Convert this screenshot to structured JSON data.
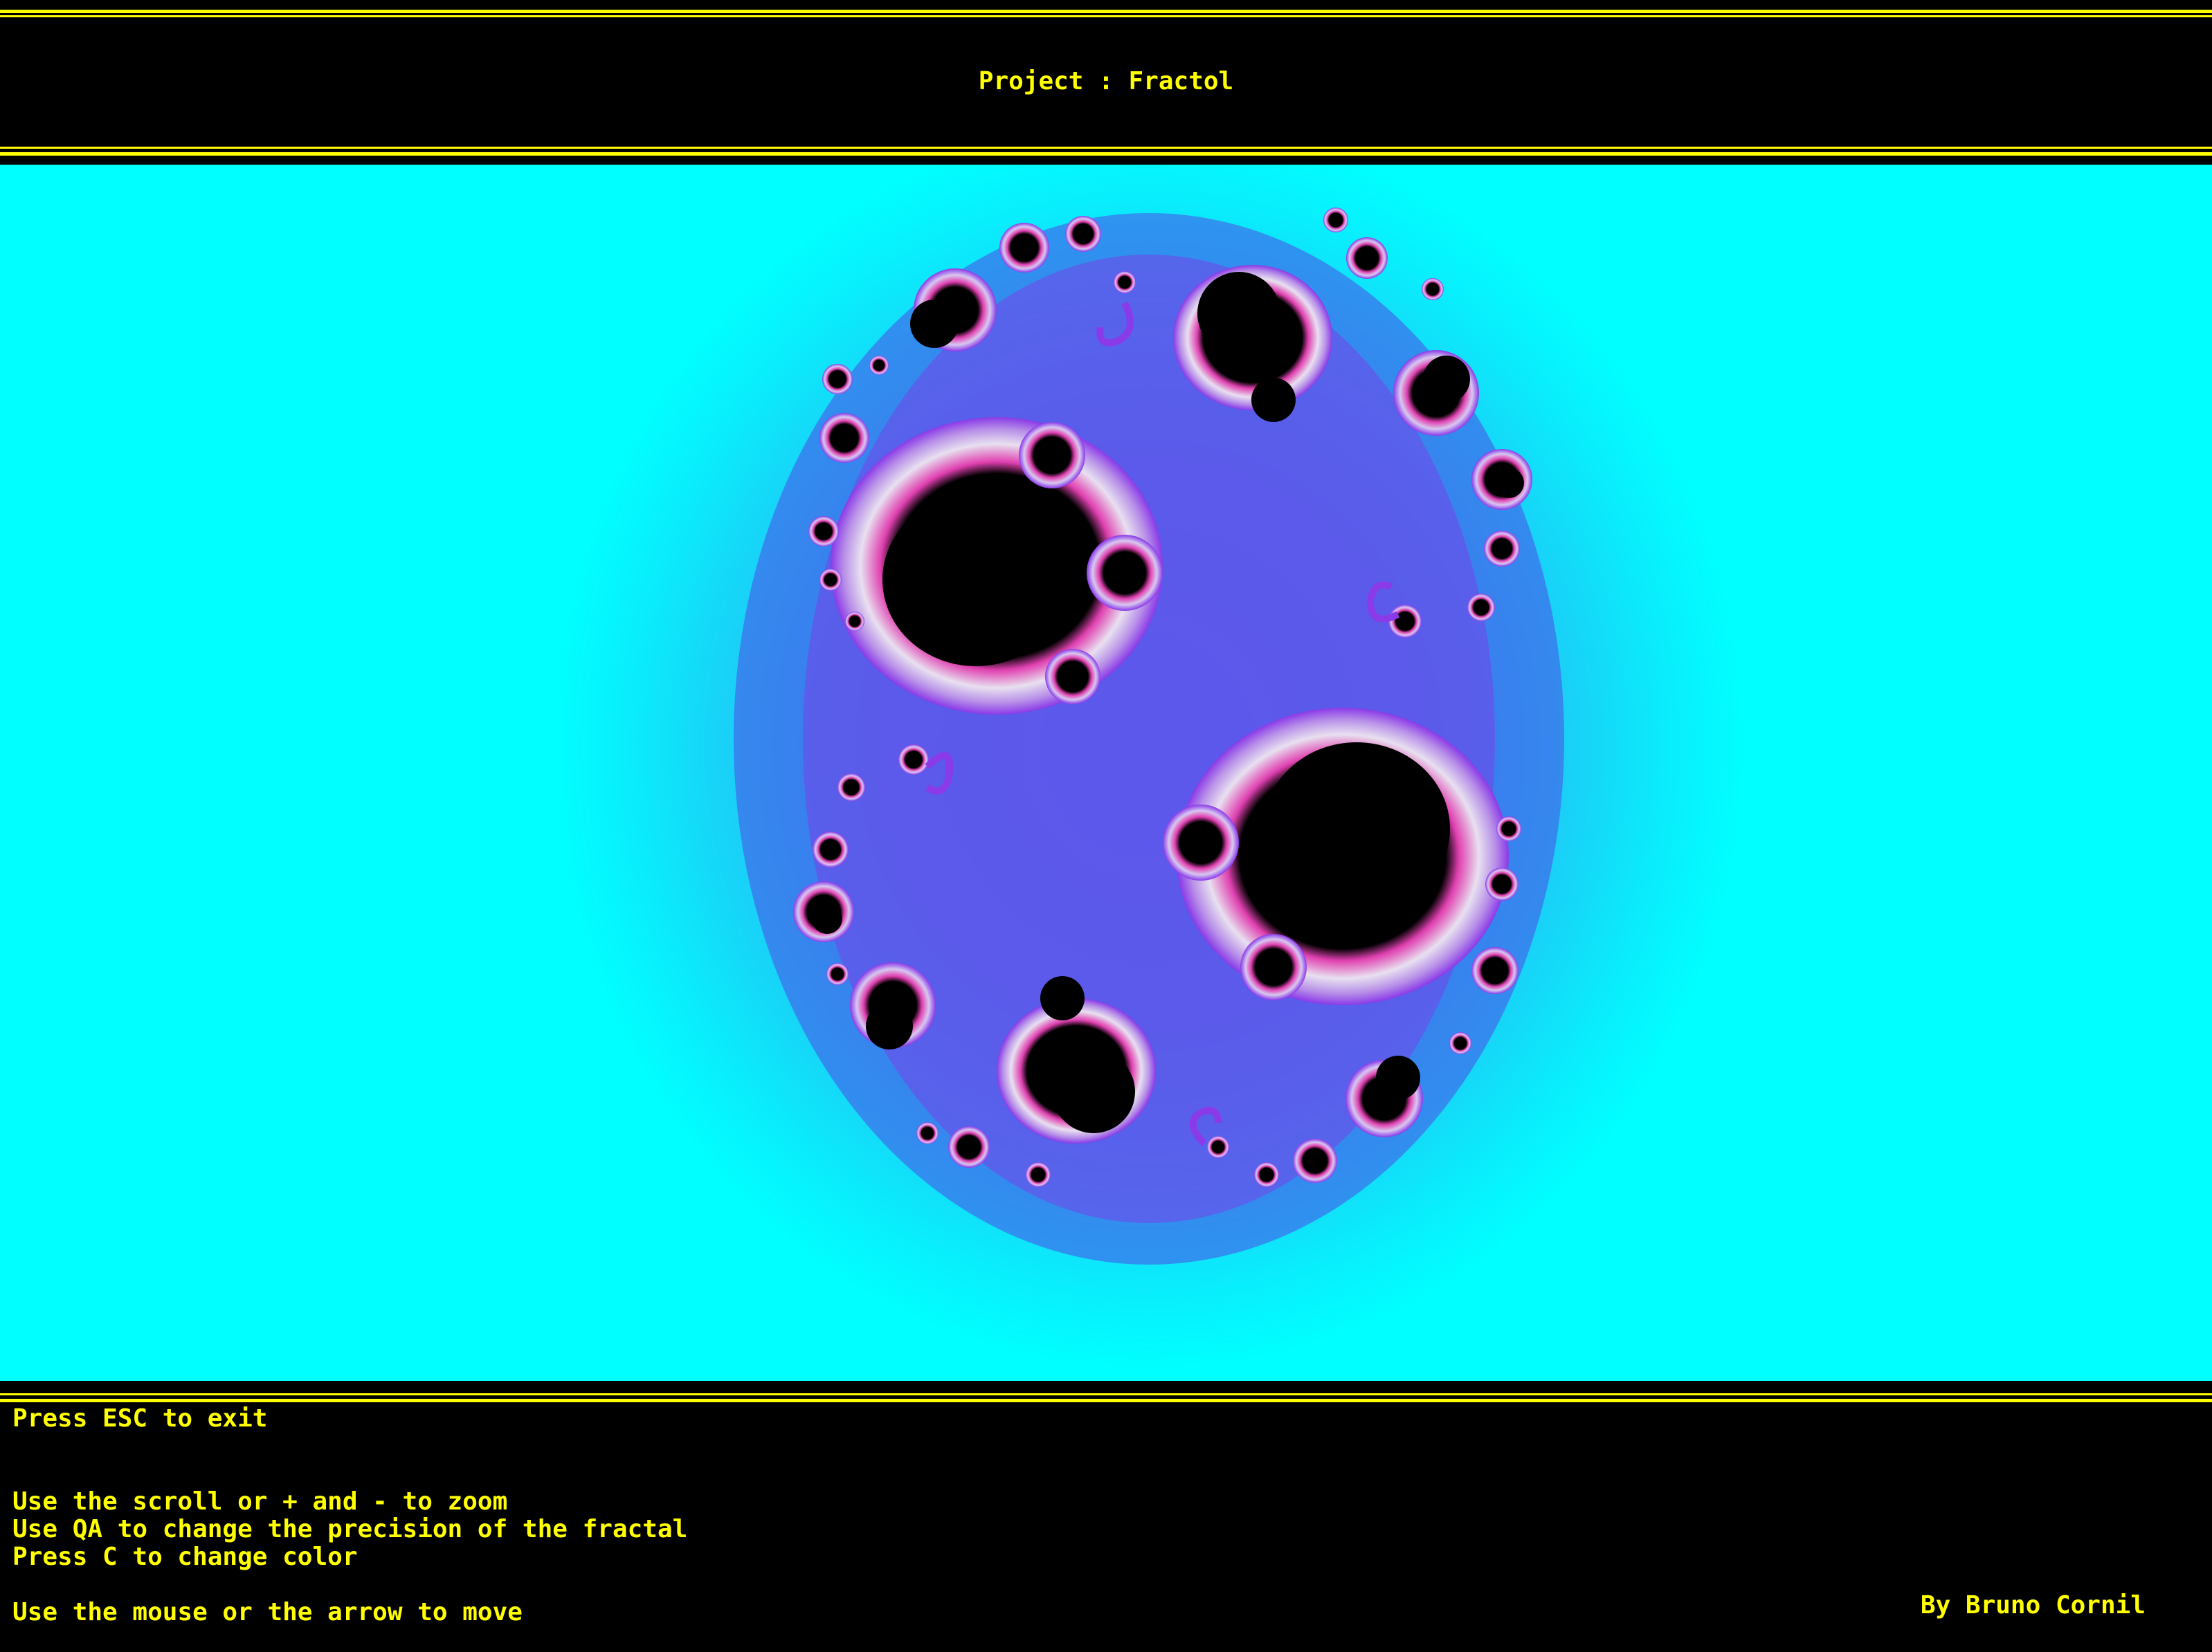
{
  "app": {
    "title": "Project : Fractol"
  },
  "fractal": {
    "type": "julia-set",
    "background_color": "#00ffff",
    "halo_color": "#4a6ae8",
    "edge_color": "#ff40c0",
    "interior_color": "#000000",
    "filament_color": "#8a3ae8"
  },
  "instructions": {
    "exit": "Press ESC to exit",
    "zoom": "Use the scroll or + and - to zoom",
    "precision": "Use QA to change the precision of the fractal",
    "color": "Press C to change color",
    "move": "Use the mouse or the arrow to move"
  },
  "credits": {
    "author": "By Bruno Cornil"
  },
  "colors": {
    "text": "#ffff00",
    "frame": "#000000",
    "rule": "#ffff00"
  }
}
